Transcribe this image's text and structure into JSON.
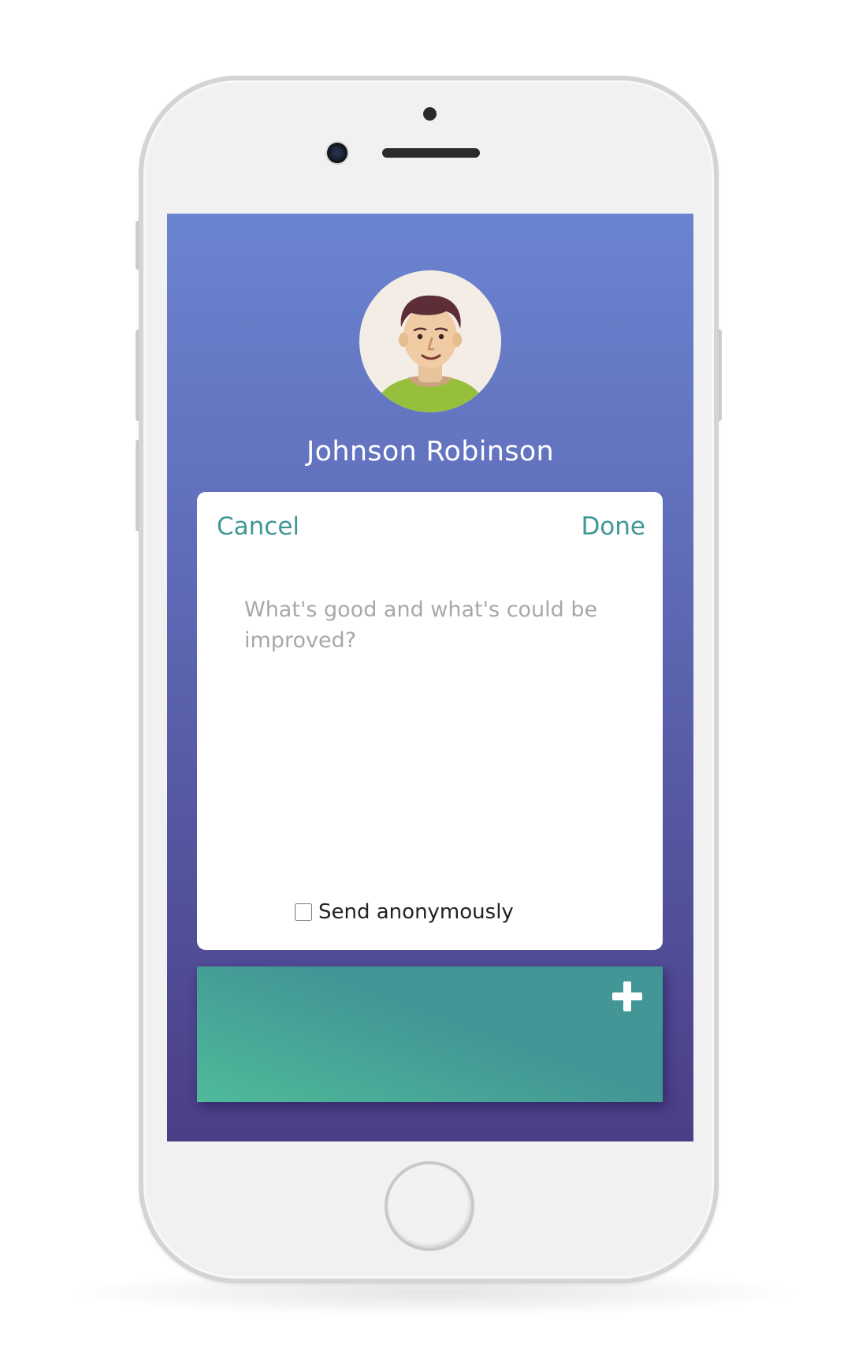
{
  "profile": {
    "name": "Johnson Robinson",
    "avatar_icon": "user-avatar-icon"
  },
  "feedback_card": {
    "cancel_label": "Cancel",
    "done_label": "Done",
    "input_placeholder": "What's good and what's could be improved?",
    "input_value": "",
    "anonymous_label": "Send anonymously",
    "anonymous_checked": false
  },
  "add_panel": {
    "icon": "plus-icon"
  },
  "colors": {
    "accent_teal": "#3f9796",
    "screen_gradient_top": "#6b84d0",
    "screen_gradient_bottom": "#4b3e86",
    "panel_green": "#4fba9a"
  }
}
